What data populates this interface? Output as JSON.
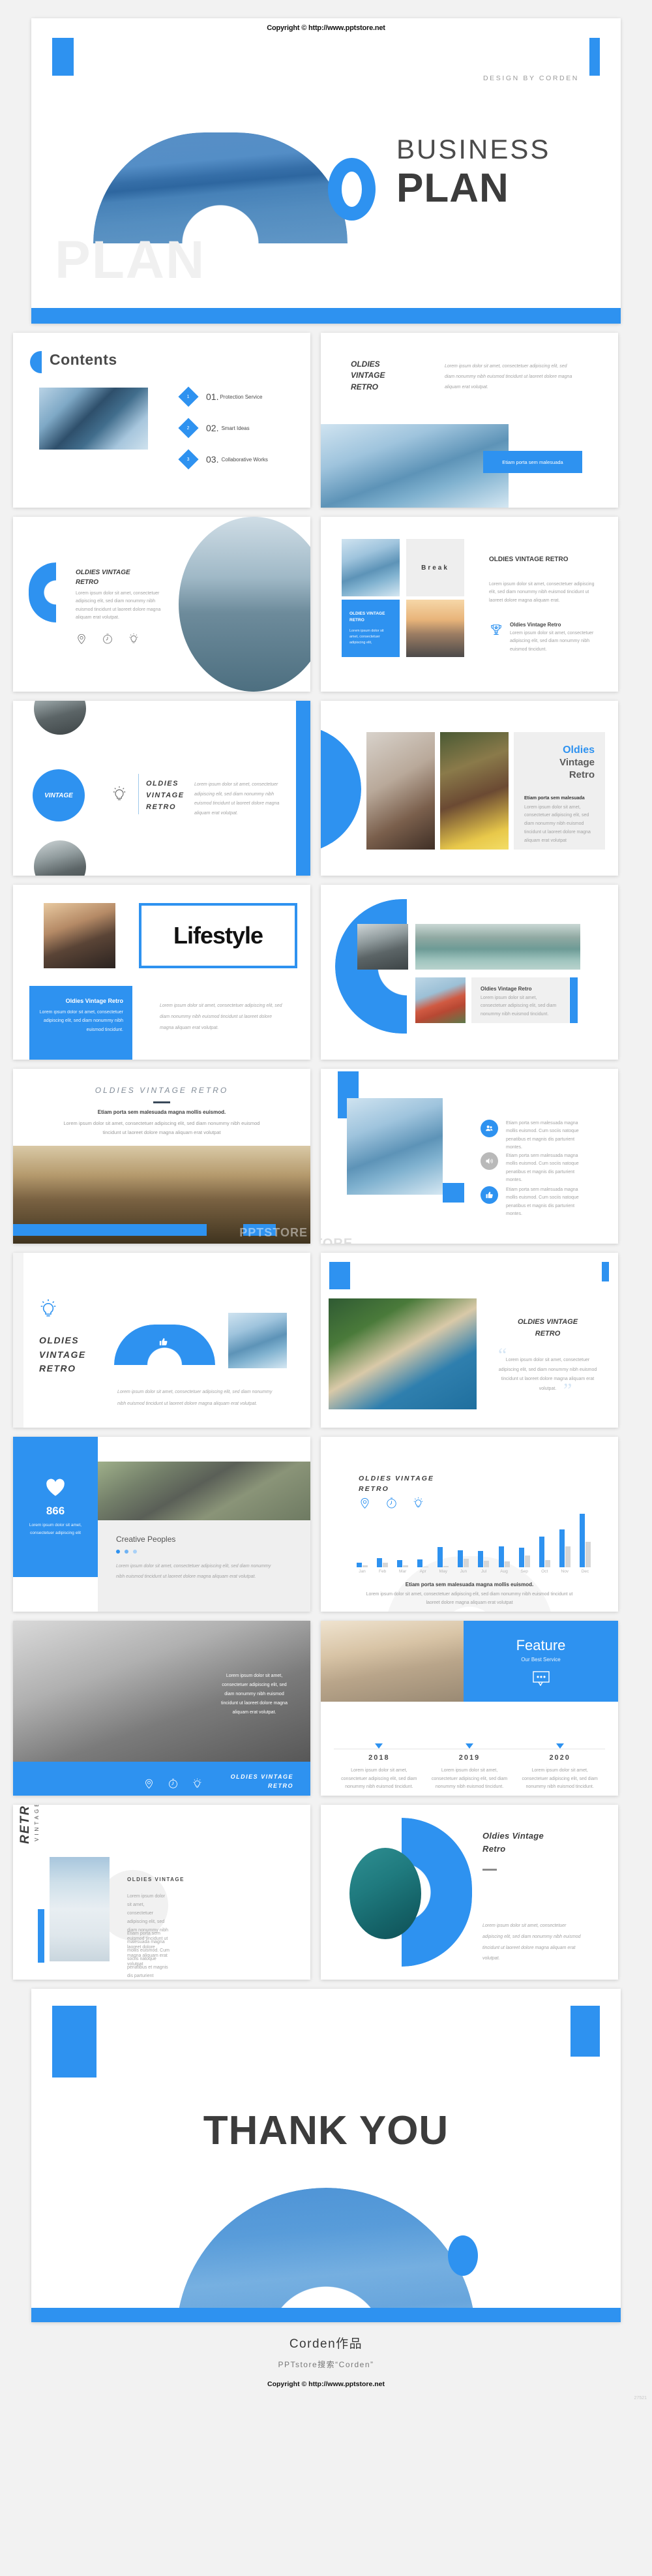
{
  "brand_color": "#2e92f0",
  "header": {
    "copyright": "Copyright © http://www.pptstore.net"
  },
  "hero": {
    "design_by": "DESIGN BY CORDEN",
    "title_line1": "BUSINESS",
    "title_line2": "PLAN",
    "ghost_text": "PLAN"
  },
  "contents": {
    "title": "Contents",
    "items": [
      {
        "badge": "1",
        "number": "01.",
        "label": "Protection Service"
      },
      {
        "badge": "2",
        "number": "02.",
        "label": "Smart Ideas"
      },
      {
        "badge": "3",
        "number": "03.",
        "label": "Collaborative Works"
      }
    ]
  },
  "slide_intro": {
    "heading_l1": "OLDIES",
    "heading_l2": "VINTAGE",
    "heading_l3": "RETRO",
    "body": "Lorem ipsum dolor sit amet, consectetuer adipiscing elit, sed diam nonummy nibh euismod tincidunt ut laoreet dolore magna aliquam erat volutpat.",
    "button": "Etiam porta sem malesuada"
  },
  "slide_dive": {
    "heading": "OLDIES VINTAGE RETRO",
    "body": "Lorem ipsum dolor sit amet, consectetuer adipiscing elit, sed diam nonummy nibh euismod tincidunt ut laoreet dolore magna aliquam erat volutpat.",
    "icons": [
      "location-pin-icon",
      "stopwatch-icon",
      "lightbulb-icon"
    ]
  },
  "slide_break": {
    "break_label": "Break",
    "tile_title": "OLDIES VINTAGE RETRO",
    "tile_body": "Lorem ipsum dolor sit amet, consectetuer adipiscing elit,",
    "heading": "OLDIES VINTAGE RETRO",
    "body": "Lorem ipsum dolor sit amet, consectetuer adipiscing elit, sed diam nonummy nibh euismod tincidunt ut laoreet dolore magna aliquam erat.",
    "sub_title": "Oldies Vintage Retro",
    "sub_body": "Lorem ipsum dolor sit amet, consectetuer adipiscing elit, sed diam nonummy nibh euismod tincidunt."
  },
  "slide_vintage": {
    "circle_label": "VINTAGE",
    "heading_l1": "OLDIES",
    "heading_l2": "VINTAGE",
    "heading_l3": "RETRO",
    "body": "Lorem ipsum dolor sit amet, consectetuer adipiscing elit, sed diam nonummy nibh euismod tincidunt ut laoreet dolore magna aliquam erat volutpat."
  },
  "slide_oldies_panel": {
    "t1": "Oldies",
    "t2": "Vintage",
    "t3": "Retro",
    "sub_title": "Etiam porta sem malesuada",
    "body": "Lorem ipsum dolor sit amet, consectetuer adipiscing elit, sed diam nonummy nibh euismod tincidunt ut laoreet dolore magna aliquam erat volutpat"
  },
  "slide_lifestyle": {
    "title": "Lifestyle",
    "card_title": "Oldies Vintage Retro",
    "card_body": "Lorem ipsum dolor sit amet, consectetuer adipiscing elit, sed diam nonummy nibh euismod tincidunt.",
    "body": "Lorem ipsum dolor sit amet, consectetuer adipiscing elit, sed diam nonummy nibh euismod tincidunt ut laoreet dolore magna aliquam erat volutpat."
  },
  "slide_gallery": {
    "card_title": "Oldies Vintage Retro",
    "card_body": "Lorem ipsum dolor sit amet, consectetuer adipiscing elit, sed diam nonummy nibh euismod tincidunt."
  },
  "slide_crowd": {
    "heading": "OLDIES VINTAGE RETRO",
    "lead": "Etiam porta sem malesuada magna mollis euismod.",
    "body": "Lorem ipsum dolor sit amet, consectetuer adipiscing elit, sed diam nonummy nibh euismod tincidunt ut laoreet dolore magna aliquam erat volutpat",
    "watermark": "PPTSTORE"
  },
  "slide_features3": {
    "items": [
      {
        "icon": "users-icon",
        "text": "Etiam porta sem malesuada magna mollis euismod. Cum sociis natoque penatibus et magnis dis parturient montes.",
        "active": true
      },
      {
        "icon": "speaker-icon",
        "text": "Etiam porta sem malesuada magna mollis euismod. Cum sociis natoque penatibus et magnis dis parturient montes.",
        "active": false
      },
      {
        "icon": "thumbs-up-icon",
        "text": "Etiam porta sem malesuada magna mollis euismod. Cum sociis natoque penatibus et magnis dis parturient montes.",
        "active": true
      }
    ]
  },
  "slide_arch": {
    "heading_l1": "OLDIES",
    "heading_l2": "VINTAGE",
    "heading_l3": "RETRO",
    "body": "Lorem ipsum dolor sit amet, consectetuer adipiscing elit, sed diam nonummy nibh euismod tincidunt ut laoreet dolore magna aliquam erat volutpat."
  },
  "slide_quote": {
    "heading_l1": "OLDIES VINTAGE",
    "heading_l2": "RETRO",
    "quote": "Lorem ipsum dolor sit amet, consectetuer adipiscing elit, sed diam nonummy nibh euismod tincidunt ut laoreet dolore magna aliquam erat volutpat."
  },
  "slide_counter": {
    "icon": "heart-icon",
    "count": "866",
    "count_body": "Lorem ipsum dolor sit amet, consectetuer adipiscing elit",
    "title": "Creative Peoples",
    "body": "Lorem ipsum dolor sit amet, consectetuer adipiscing elit, sed diam nonummy nibh euismod tincidunt ut laoreet dolore magna aliquam erat volutpat."
  },
  "slide_chart": {
    "heading_l1": "OLDIES VINTAGE",
    "heading_l2": "RETRO",
    "icons": [
      "location-pin-icon",
      "stopwatch-icon",
      "lightbulb-icon"
    ],
    "lead": "Etiam porta sem malesuada magna mollis euismod.",
    "body": "Lorem ipsum dolor sit amet, consectetuer adipiscing elit, sed diam nonummy nibh euismod tincidunt ut laoreet dolore magna aliquam erat volutpat"
  },
  "chart_data": {
    "type": "bar",
    "title": "",
    "xlabel": "",
    "ylabel": "",
    "ylim": [
      0,
      100
    ],
    "grid": false,
    "legend": "none",
    "categories": [
      "Jan",
      "Feb",
      "Mar",
      "Apr",
      "May",
      "Jun",
      "Jul",
      "Aug",
      "Sep",
      "Oct",
      "Nov",
      "Dec"
    ],
    "series": [
      {
        "name": "Series 1",
        "color": "#2e92f0",
        "values": [
          8,
          17,
          13,
          15,
          38,
          32,
          30,
          39,
          37,
          57,
          71,
          100
        ]
      },
      {
        "name": "Series 2",
        "color": "#d6d6d6",
        "values": [
          4,
          8,
          4,
          1,
          3,
          16,
          12,
          11,
          22,
          13,
          39,
          48
        ]
      }
    ]
  },
  "slide_guitar": {
    "body": "Lorem ipsum dolor sit amet, consectetuer adipiscing elit, sed diam nonummy nibh euismod tincidunt ut laoreet dolore magna aliquam erat volutpat.",
    "bar_title_l1": "OLDIES VINTAGE",
    "bar_title_l2": "RETRO",
    "icons": [
      "location-pin-icon",
      "stopwatch-icon",
      "lightbulb-icon"
    ]
  },
  "slide_feature": {
    "title": "Feature",
    "subtitle": "Our Best Service",
    "icon": "chat-bubble-icon",
    "timeline": [
      {
        "year": "2018",
        "body": "Lorem ipsum dolor sit amet, consectetuer adipiscing elit, sed diam nonummy nibh euismod tincidunt."
      },
      {
        "year": "2019",
        "body": "Lorem ipsum dolor sit amet, consectetuer adipiscing elit, sed diam nonummy nibh euismod tincidunt."
      },
      {
        "year": "2020",
        "body": "Lorem ipsum dolor sit amet, consectetuer adipiscing elit, sed diam nonummy nibh euismod tincidunt."
      }
    ]
  },
  "slide_retro": {
    "vertical_l1": "RETRO",
    "vertical_l2": "VINTAGE",
    "heading": "OLDIES VINTAGE",
    "body1": "Lorem ipsum dolor sit amet, consectetuer adipiscing elit, sed diam nonummy nibh euismod tincidunt ut laoreet dolore magna aliquam erat volutpat",
    "body2": "Etiam porta sem malesuada magna mollis euismod. Cum sociis natoque penatibus et magnis dis parturient montes."
  },
  "slide_portrait": {
    "heading_l1": "Oldies Vintage",
    "heading_l2": "Retro",
    "body": "Lorem ipsum dolor sit amet, consectetuer adipiscing elit, sed diam nonummy nibh euismod tincidunt ut laoreet dolore magna aliquam erat volutpat."
  },
  "slide_thanks": {
    "title": "THANK YOU"
  },
  "footer": {
    "line1": "Corden作品",
    "line2": "PPTstore搜索“Corden”",
    "line3": "Copyright © http://www.pptstore.net",
    "serial": "27521"
  }
}
